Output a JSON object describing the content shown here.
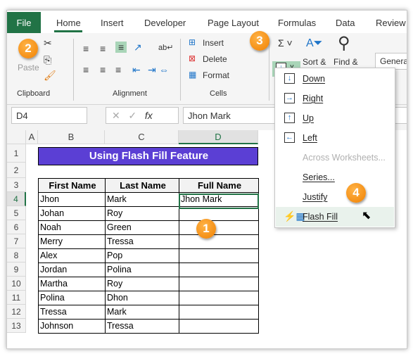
{
  "tabs": [
    "File",
    "Home",
    "Insert",
    "Developer",
    "Page Layout",
    "Formulas",
    "Data",
    "Review"
  ],
  "ribbon": {
    "paste": "Paste",
    "clipboard": "Clipboard",
    "alignment": "Alignment",
    "insert": "Insert",
    "delete": "Delete",
    "format": "Format",
    "cells": "Cells",
    "sort": "Sort &",
    "find": "Find &",
    "number_format": "General"
  },
  "formula_bar": {
    "name_box": "D4",
    "value": "Jhon Mark",
    "fx": "fx"
  },
  "columns": [
    "A",
    "B",
    "C",
    "D"
  ],
  "rows": [
    "1",
    "2",
    "3",
    "4",
    "5",
    "6",
    "7",
    "8",
    "9",
    "10",
    "11",
    "12",
    "13"
  ],
  "sheet": {
    "title": "Using Flash Fill Feature",
    "headers": [
      "First Name",
      "Last Name",
      "Full Name"
    ],
    "data": [
      [
        "Jhon",
        "Mark",
        "Jhon Mark"
      ],
      [
        "Johan",
        "Roy",
        ""
      ],
      [
        "Noah",
        "Green",
        ""
      ],
      [
        "Merry",
        "Tressa",
        ""
      ],
      [
        "Alex",
        "Pop",
        ""
      ],
      [
        "Jordan",
        "Polina",
        ""
      ],
      [
        "Martha",
        "Roy",
        ""
      ],
      [
        "Polina",
        "Dhon",
        ""
      ],
      [
        "Tressa",
        "Mark",
        ""
      ],
      [
        "Johnson",
        "Tressa",
        ""
      ]
    ]
  },
  "fill_menu": [
    {
      "label": "Down",
      "enabled": true
    },
    {
      "label": "Right",
      "enabled": true
    },
    {
      "label": "Up",
      "enabled": true
    },
    {
      "label": "Left",
      "enabled": true
    },
    {
      "label": "Across Worksheets...",
      "enabled": false
    },
    {
      "label": "Series...",
      "enabled": true
    },
    {
      "label": "Justify",
      "enabled": true
    },
    {
      "label": "Flash Fill",
      "enabled": true,
      "highlighted": true
    }
  ],
  "badges": [
    "1",
    "2",
    "3",
    "4"
  ],
  "colors": {
    "file_tab": "#217346",
    "title_fill": "#5b3fd4",
    "selection": "#217346",
    "badge": "#f08000",
    "highlight": "#e9f2ec"
  }
}
